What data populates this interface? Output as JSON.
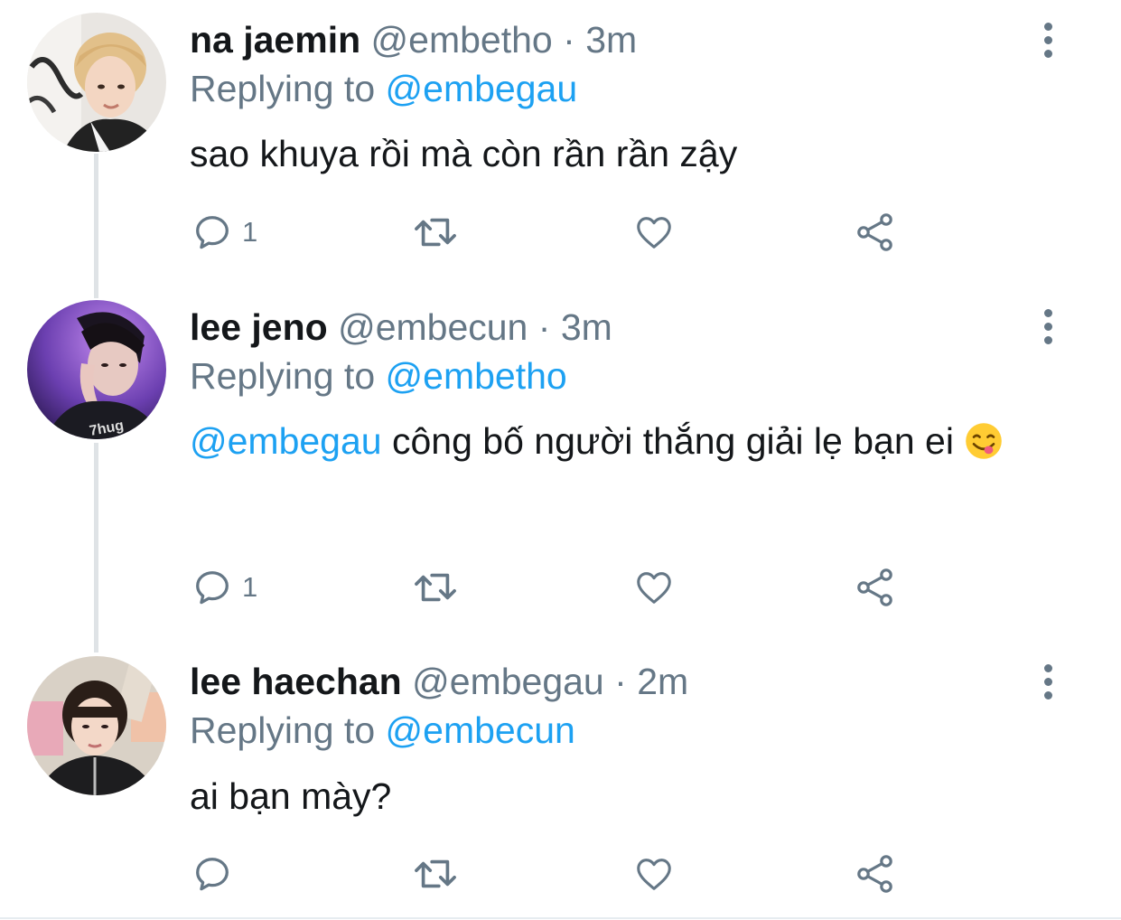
{
  "tweets": [
    {
      "name": "na jaemin",
      "handle": "@embetho",
      "separator": "·",
      "time": "3m",
      "replying_prefix": "Replying to",
      "replying_to": "@embegau",
      "text": "sao khuya rồi mà còn rần rần zậy",
      "reply_count": "1"
    },
    {
      "name": "lee jeno",
      "handle": "@embecun",
      "separator": "·",
      "time": "3m",
      "replying_prefix": "Replying to",
      "replying_to": "@embetho",
      "text_mention": "@embegau",
      "text": "công bố người thắng giải lẹ bạn ei",
      "emoji": "yum-face-emoji",
      "reply_count": "1"
    },
    {
      "name": "lee haechan",
      "handle": "@embegau",
      "separator": "·",
      "time": "2m",
      "replying_prefix": "Replying to",
      "replying_to": "@embecun",
      "text": "ai bạn mày?",
      "reply_count": ""
    }
  ],
  "icons": {
    "reply": "reply-icon",
    "retweet": "retweet-icon",
    "like": "heart-icon",
    "share": "share-icon",
    "more": "more-options-icon"
  },
  "colors": {
    "text": "#14171a",
    "secondary": "#657786",
    "accent": "#1da1f2",
    "thread_line": "#dfe3e6"
  }
}
